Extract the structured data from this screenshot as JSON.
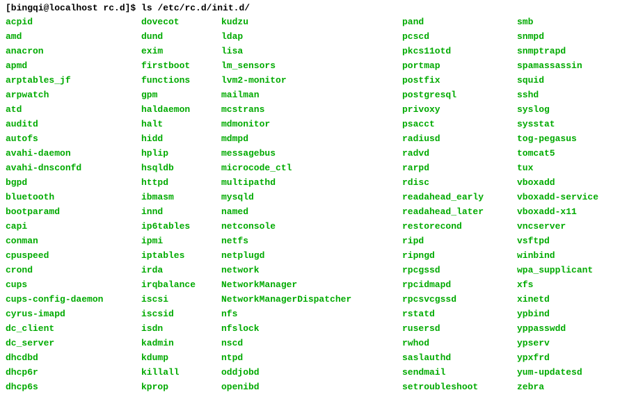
{
  "prompt": "[bingqi@localhost rc.d]$ ",
  "command": "ls /etc/rc.d/init.d/",
  "columns": [
    [
      "acpid",
      "amd",
      "anacron",
      "apmd",
      "arptables_jf",
      "arpwatch",
      "atd",
      "auditd",
      "autofs",
      "avahi-daemon",
      "avahi-dnsconfd",
      "bgpd",
      "bluetooth",
      "bootparamd",
      "capi",
      "conman",
      "cpuspeed",
      "crond",
      "cups",
      "cups-config-daemon",
      "cyrus-imapd",
      "dc_client",
      "dc_server",
      "dhcdbd",
      "dhcp6r",
      "dhcp6s"
    ],
    [
      "dovecot",
      "dund",
      "exim",
      "firstboot",
      "functions",
      "gpm",
      "haldaemon",
      "halt",
      "hidd",
      "hplip",
      "hsqldb",
      "httpd",
      "ibmasm",
      "innd",
      "ip6tables",
      "ipmi",
      "iptables",
      "irda",
      "irqbalance",
      "iscsi",
      "iscsid",
      "isdn",
      "kadmin",
      "kdump",
      "killall",
      "kprop"
    ],
    [
      "kudzu",
      "ldap",
      "lisa",
      "lm_sensors",
      "lvm2-monitor",
      "mailman",
      "mcstrans",
      "mdmonitor",
      "mdmpd",
      "messagebus",
      "microcode_ctl",
      "multipathd",
      "mysqld",
      "named",
      "netconsole",
      "netfs",
      "netplugd",
      "network",
      "NetworkManager",
      "NetworkManagerDispatcher",
      "nfs",
      "nfslock",
      "nscd",
      "ntpd",
      "oddjobd",
      "openibd"
    ],
    [
      "pand",
      "pcscd",
      "pkcs11otd",
      "portmap",
      "postfix",
      "postgresql",
      "privoxy",
      "psacct",
      "radiusd",
      "radvd",
      "rarpd",
      "rdisc",
      "readahead_early",
      "readahead_later",
      "restorecond",
      "ripd",
      "ripngd",
      "rpcgssd",
      "rpcidmapd",
      "rpcsvcgssd",
      "rstatd",
      "rusersd",
      "rwhod",
      "saslauthd",
      "sendmail",
      "setroubleshoot"
    ],
    [
      "smb",
      "snmpd",
      "snmptrapd",
      "spamassassin",
      "squid",
      "sshd",
      "syslog",
      "sysstat",
      "tog-pegasus",
      "tomcat5",
      "tux",
      "vboxadd",
      "vboxadd-service",
      "vboxadd-x11",
      "vncserver",
      "vsftpd",
      "winbind",
      "wpa_supplicant",
      "xfs",
      "xinetd",
      "ypbind",
      "yppasswdd",
      "ypserv",
      "ypxfrd",
      "yum-updatesd",
      "zebra"
    ]
  ]
}
